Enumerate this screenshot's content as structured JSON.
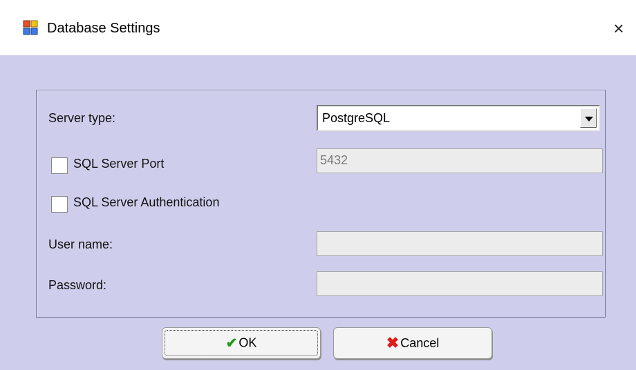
{
  "window": {
    "title": "Database Settings",
    "close_glyph": "×",
    "app_icon": "app-grid-icon"
  },
  "form": {
    "server_type_label": "Server type:",
    "server_type_value": "PostgreSQL",
    "port_label": "SQL Server Port",
    "port_checked": false,
    "port_value": "5432",
    "auth_label": "SQL Server Authentication",
    "auth_checked": false,
    "username_label": "User name:",
    "username_value": "",
    "password_label": "Password:",
    "password_value": ""
  },
  "buttons": {
    "ok_label": "OK",
    "ok_icon": "checkmark-icon",
    "cancel_label": "Cancel",
    "cancel_icon": "x-mark-icon"
  },
  "colors": {
    "dialog_background": "#ceceec",
    "ok_icon_color": "#1f9b1f",
    "cancel_icon_color": "#e01b1b"
  }
}
